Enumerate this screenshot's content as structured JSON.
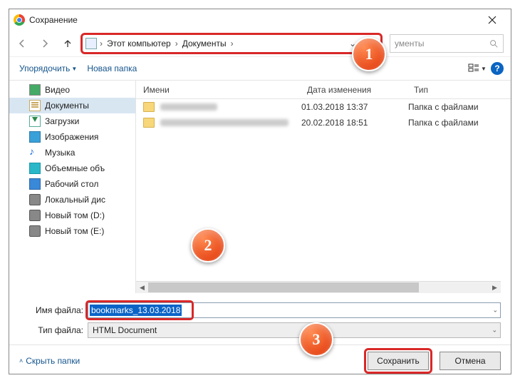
{
  "window": {
    "title": "Сохранение"
  },
  "breadcrumb": {
    "seg1": "Этот компьютер",
    "seg2": "Документы"
  },
  "search": {
    "placeholder": "ументы"
  },
  "toolbar": {
    "organize": "Упорядочить",
    "newfolder": "Новая папка"
  },
  "sidebar": {
    "items": [
      {
        "label": "Видео"
      },
      {
        "label": "Документы"
      },
      {
        "label": "Загрузки"
      },
      {
        "label": "Изображения"
      },
      {
        "label": "Музыка"
      },
      {
        "label": "Объемные объ"
      },
      {
        "label": "Рабочий стол"
      },
      {
        "label": "Локальный дис"
      },
      {
        "label": "Новый том (D:)"
      },
      {
        "label": "Новый том (E:)"
      }
    ]
  },
  "columns": {
    "name": "Имени",
    "date": "Дата изменения",
    "type": "Тип"
  },
  "rows": [
    {
      "date": "01.03.2018 13:37",
      "type": "Папка с файлами"
    },
    {
      "date": "20.02.2018 18:51",
      "type": "Папка с файлами"
    }
  ],
  "fields": {
    "filename_label": "Имя файла:",
    "filename_value": "bookmarks_13.03.2018",
    "filetype_label": "Тип файла:",
    "filetype_value": "HTML Document"
  },
  "footer": {
    "hide": "Скрыть папки",
    "save": "Сохранить",
    "cancel": "Отмена"
  },
  "callouts": {
    "c1": "1",
    "c2": "2",
    "c3": "3"
  }
}
